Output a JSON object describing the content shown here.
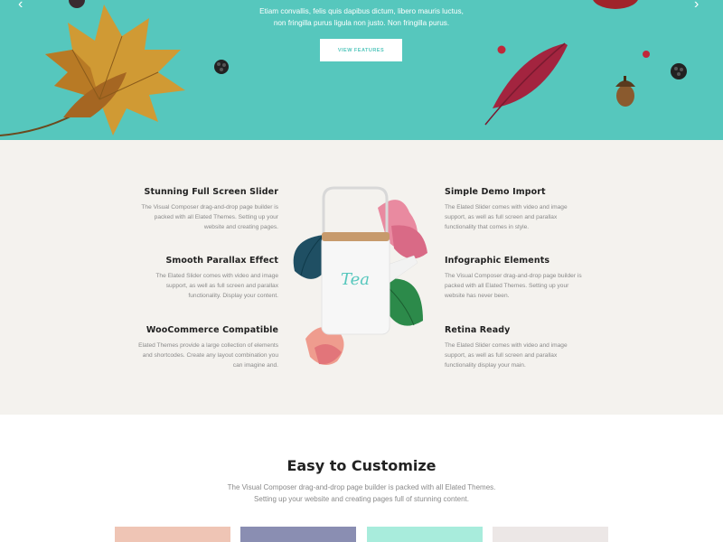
{
  "hero": {
    "text_lines": [
      "Etiam convallis, felis quis dapibus dictum, libero mauris luctus,",
      "non fringilla purus ligula non justo. Non fringilla purus."
    ],
    "button_label": "VIEW FEATURES",
    "arrow_left": "‹",
    "arrow_right": "›"
  },
  "features": {
    "teapot_label": "Tea",
    "left": [
      {
        "title": "Stunning Full Screen Slider",
        "text": "The Visual Composer drag-and-drop page builder is packed with all Elated Themes. Setting up your website and creating pages."
      },
      {
        "title": "Smooth Parallax Effect",
        "text": "The Elated Slider comes with video and image support, as well as full screen and parallax functionality. Display your content."
      },
      {
        "title": "WooCommerce Compatible",
        "text": "Elated Themes provide a large collection of elements and shortcodes. Create any layout combination you can imagine and."
      }
    ],
    "right": [
      {
        "title": "Simple Demo Import",
        "text": "The Elated Slider comes with video and image support, as well as full screen and parallax functionality that comes in style."
      },
      {
        "title": "Infographic Elements",
        "text": "The Visual Composer drag-and-drop page builder is packed with all Elated Themes. Setting up your website has never been."
      },
      {
        "title": "Retina Ready",
        "text": "The Elated Slider comes with video and image support, as well as full screen and parallax functionality display your main."
      }
    ]
  },
  "customize": {
    "title": "Easy to Customize",
    "subtitle_lines": [
      "The Visual Composer drag-and-drop page builder is packed with all Elated Themes.",
      "Setting up your website and creating pages full of stunning content."
    ]
  },
  "colors": {
    "accent": "#56c7bd",
    "features_bg": "#f4f2ee",
    "swatches": [
      "#efc5b5",
      "#8a8eb2",
      "#a8ecdc",
      "#ece7e6"
    ]
  }
}
